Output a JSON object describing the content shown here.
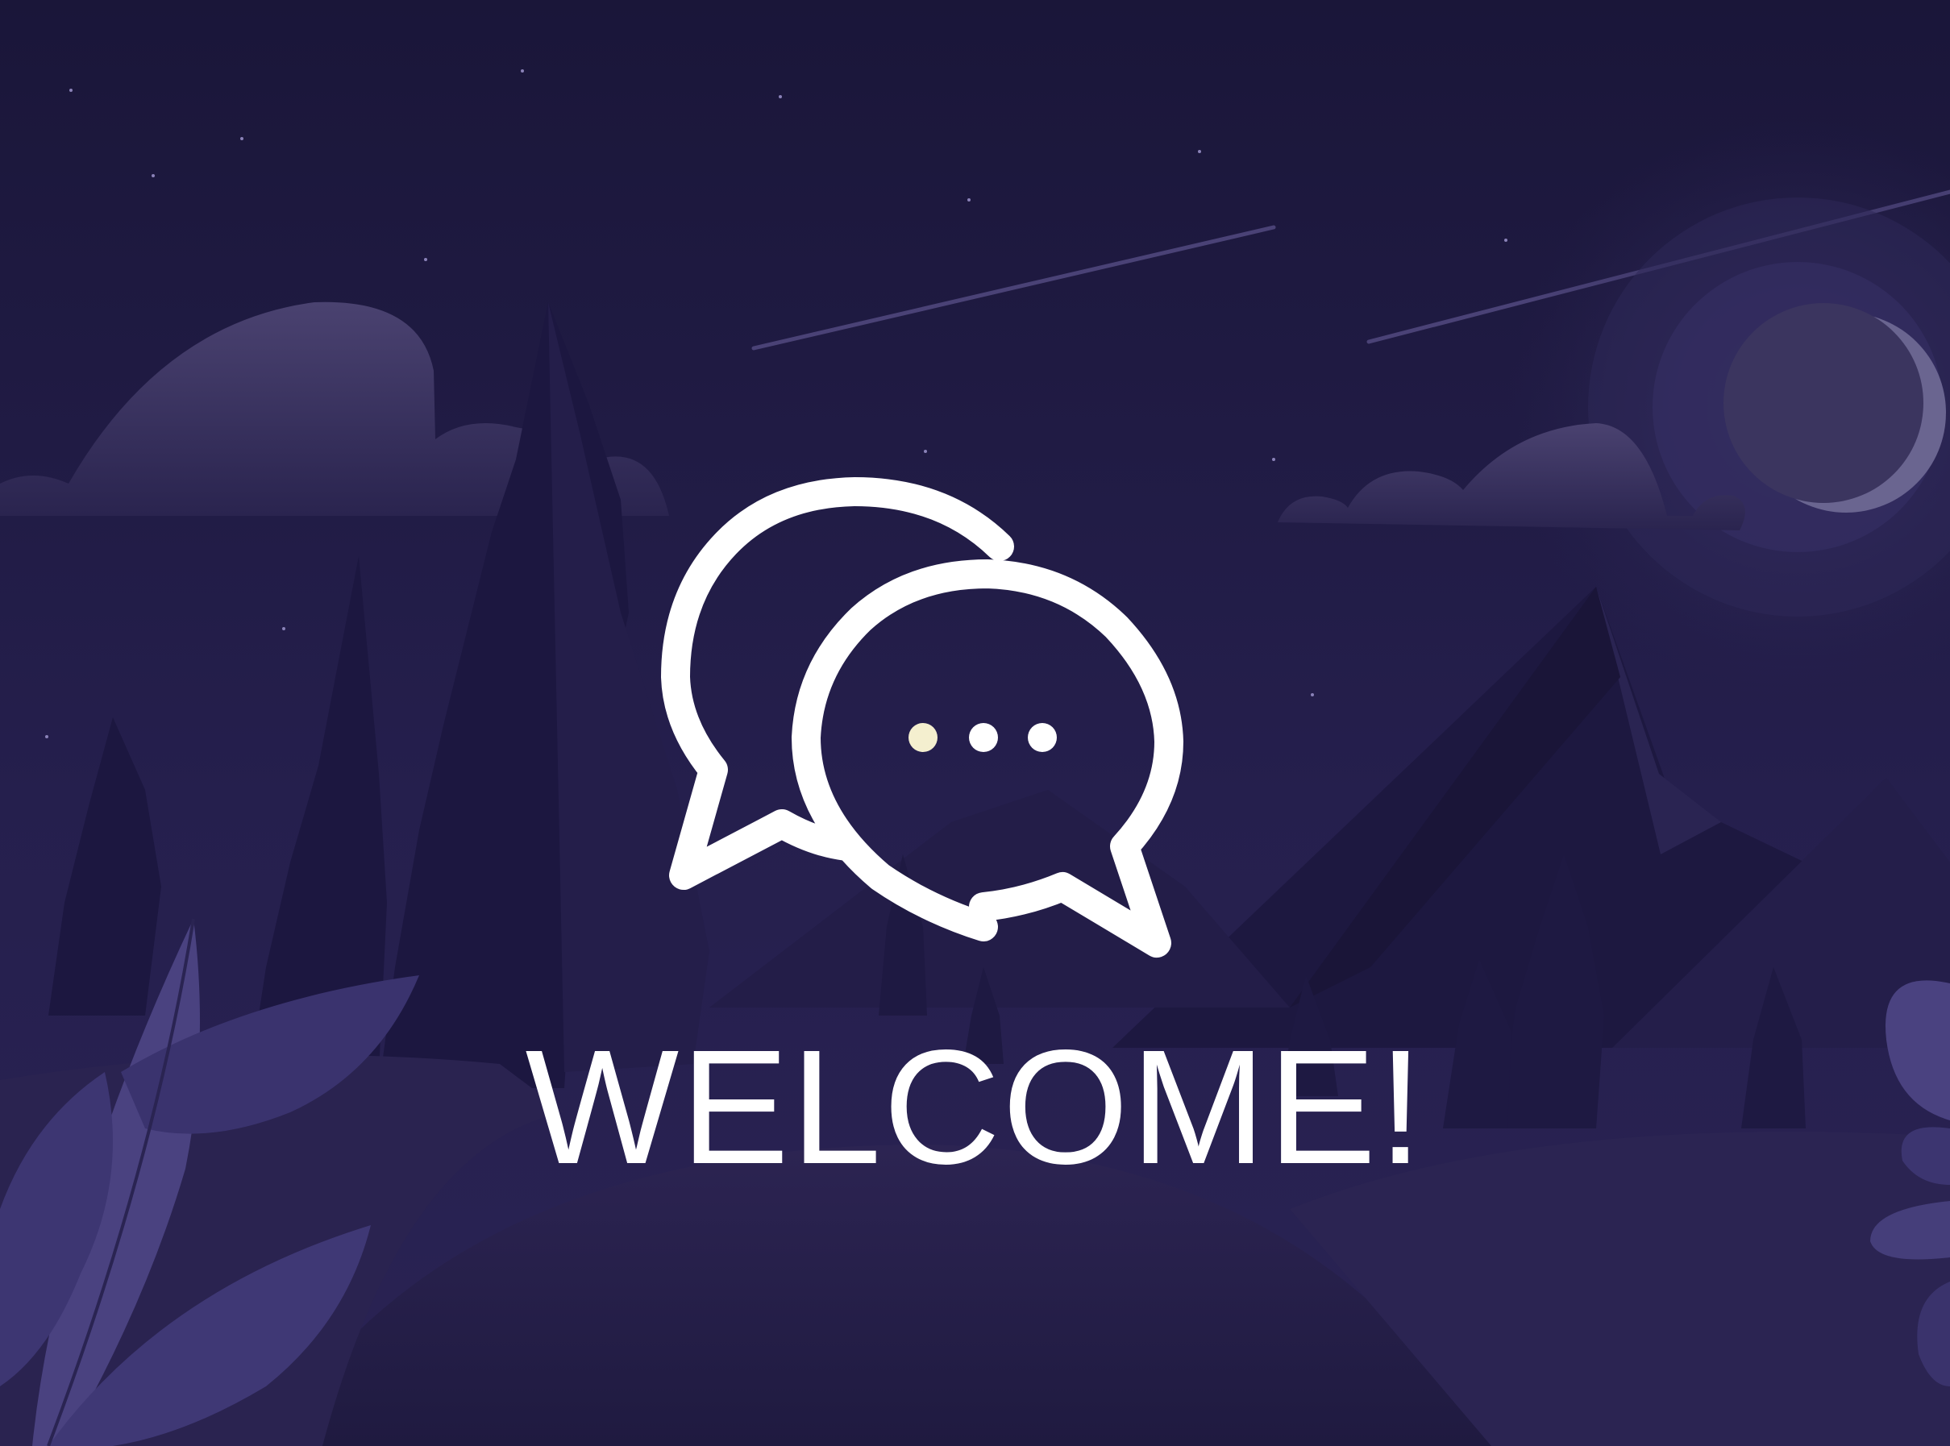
{
  "screen": {
    "name": "welcome-splash"
  },
  "welcome": {
    "title": "WELCOME!"
  },
  "icons": {
    "main": "chat-bubbles-icon",
    "typing": "typing-dots-icon"
  },
  "colors": {
    "background": "#1c1840",
    "text": "#ffffff",
    "icon_stroke": "#ffffff",
    "dot_highlight": "#f4efcf"
  }
}
